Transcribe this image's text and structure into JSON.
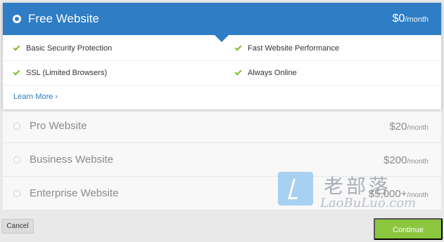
{
  "selected_plan": {
    "name": "Free Website",
    "price": "$0",
    "per": "/month",
    "features": [
      "Basic Security Protection",
      "Fast Website Performance",
      "SSL (Limited Browsers)",
      "Always Online"
    ],
    "learn_more": "Learn More ›"
  },
  "plans": [
    {
      "name": "Pro Website",
      "price": "$20",
      "per": "/month"
    },
    {
      "name": "Business Website",
      "price": "$200",
      "per": "/month"
    },
    {
      "name": "Enterprise Website",
      "price": "$5,000+",
      "per": "/month"
    }
  ],
  "watermark": {
    "title": "老部落",
    "url": "LaoBuLuo.com"
  },
  "footer": {
    "cancel_label": "Cancel",
    "continue_label": "Continue"
  },
  "colors": {
    "primary": "#2f7dc4",
    "check": "#7cbb2a",
    "continue": "#8cc63f"
  }
}
